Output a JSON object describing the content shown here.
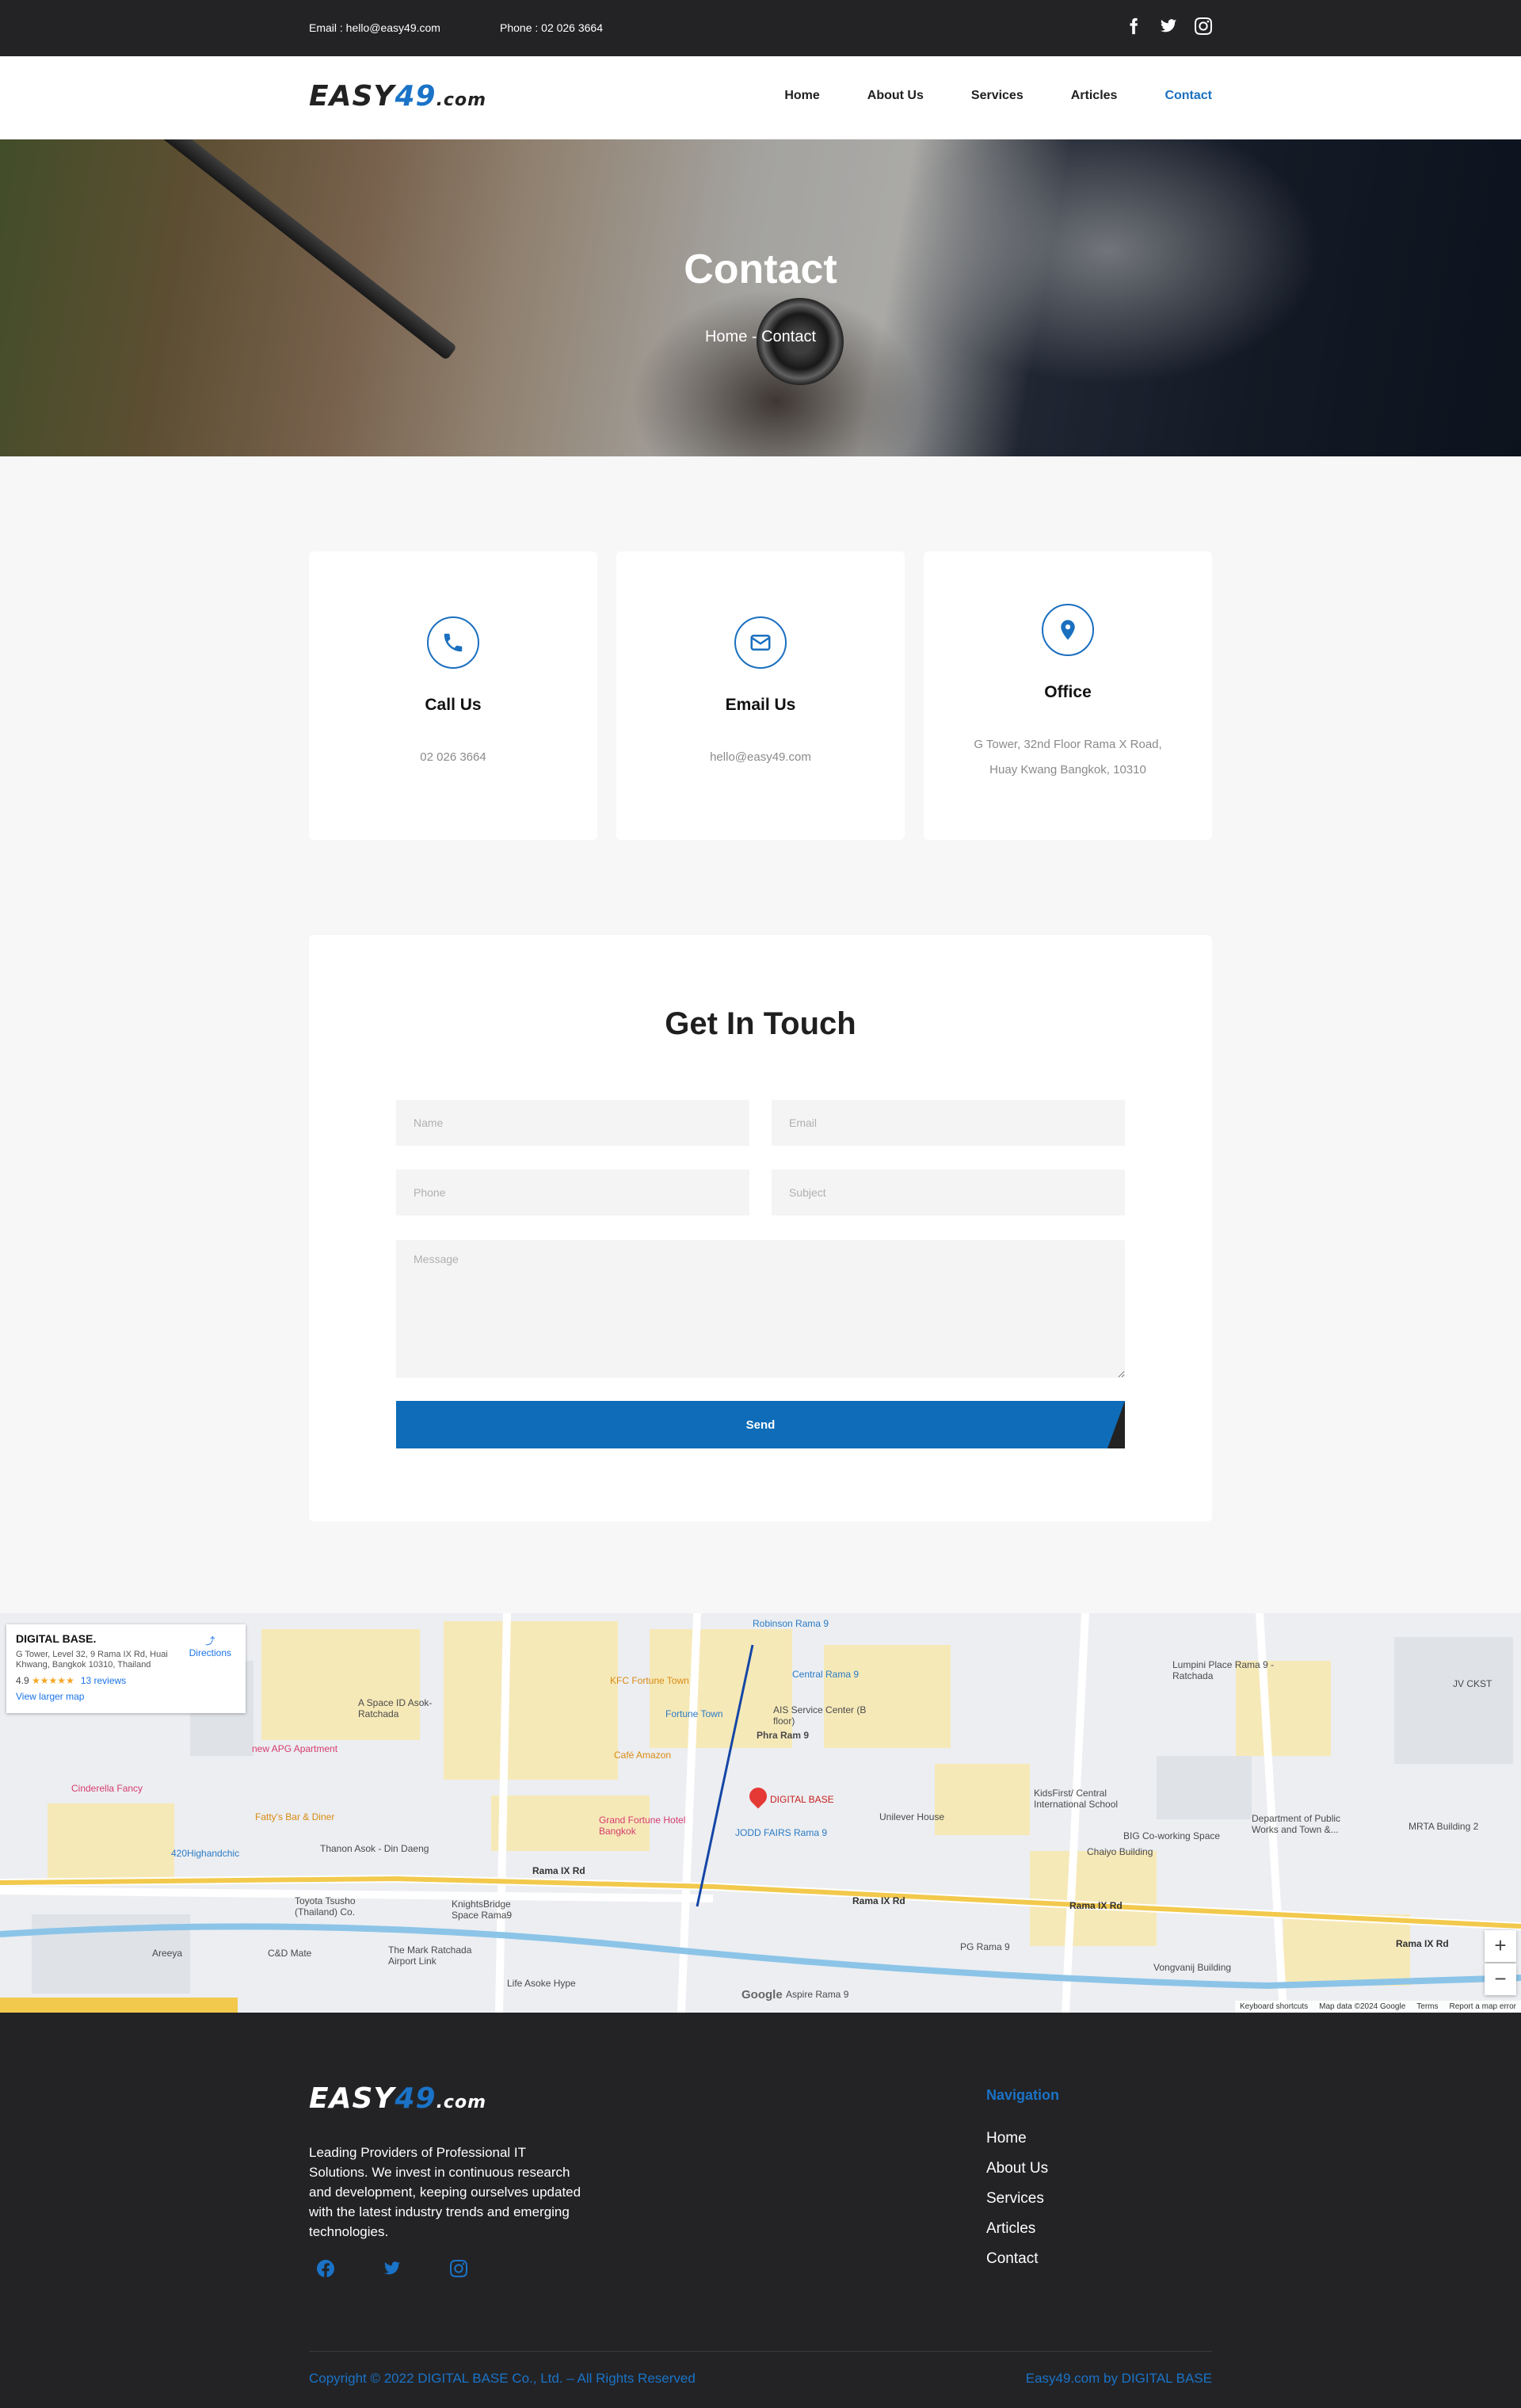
{
  "topbar": {
    "email": "Email : hello@easy49.com",
    "phone": "Phone : 02 026 3664",
    "social_icons": [
      "facebook-icon",
      "twitter-icon",
      "instagram-icon"
    ]
  },
  "logo": {
    "part1": "EASY",
    "part2": "49",
    "part3": ".com"
  },
  "nav": [
    {
      "label": "Home",
      "active": false
    },
    {
      "label": "About Us",
      "active": false
    },
    {
      "label": "Services",
      "active": false
    },
    {
      "label": "Articles",
      "active": false
    },
    {
      "label": "Contact",
      "active": true
    }
  ],
  "hero": {
    "title": "Contact",
    "breadcrumb": "Home - Contact"
  },
  "cards": [
    {
      "icon": "phone-icon",
      "title": "Call Us",
      "lines": [
        "02 026 3664"
      ]
    },
    {
      "icon": "mail-icon",
      "title": "Email Us",
      "lines": [
        "hello@easy49.com"
      ]
    },
    {
      "icon": "location-pin-icon",
      "title": "Office",
      "lines": [
        "G Tower, 32nd Floor Rama X Road,",
        "Huay Kwang Bangkok, 10310"
      ]
    }
  ],
  "form": {
    "heading": "Get In Touch",
    "name_placeholder": "Name",
    "email_placeholder": "Email",
    "phone_placeholder": "Phone",
    "subject_placeholder": "Subject",
    "message_placeholder": "Message",
    "send_label": "Send"
  },
  "map": {
    "card_title": "DIGITAL BASE.",
    "card_address": "G Tower, Level 32, 9 Rama IX Rd, Huai Khwang, Bangkok 10310, Thailand",
    "rating": "4.9",
    "stars": "★★★★★",
    "reviews": "13 reviews",
    "larger_map": "View larger map",
    "directions": "Directions",
    "marker_label": "DIGITAL BASE",
    "labels": {
      "robinson": "Robinson Rama 9",
      "central": "Central Rama 9",
      "kfc": "KFC Fortune Town",
      "fortune": "Fortune Town",
      "ais": "AIS Service Center (B floor)",
      "phraram9": "Phra Ram 9",
      "cafe": "Café Amazon",
      "grand": "Grand Fortune Hotel Bangkok",
      "joddfairs": "JODD FAIRS Rama 9",
      "unilever": "Unilever House",
      "kidsfirst": "KidsFirst/ Central International School",
      "bigcowork": "BIG Co-working Space",
      "chaiyo": "Chaiyo Building",
      "lumpini": "Lumpini Place Rama 9 - Ratchada",
      "apg": "new APG Apartment",
      "cinderella": "Cinderella Fancy",
      "fattys": "Fatty's Bar & Diner",
      "highandchic": "420Highandchic",
      "asoke": "Thanon Asok - Din Daeng",
      "toyota": "Toyota Tsusho (Thailand) Co.",
      "knights": "KnightsBridge Space Rama9",
      "mark": "The Mark Ratchada Airport Link",
      "cdmate": "C&D Mate",
      "areeya": "Areeya",
      "lifeasoke": "Life Asoke Hype",
      "aspire": "Aspire Rama 9",
      "pgrama9": "PG Rama 9",
      "vongvanij": "Vongvanij Building",
      "dept": "Department of Public Works and Town &...",
      "mrta": "MRTA Building 2",
      "jvckst": "JV CKST",
      "rama9rd": "Rama IX Rd",
      "asokespace": "A Space ID Asok-Ratchada"
    },
    "attribution": [
      "Keyboard shortcuts",
      "Map data ©2024 Google",
      "Terms",
      "Report a map error"
    ],
    "zoom_in": "+",
    "zoom_out": "−",
    "google_label": "Google"
  },
  "footer": {
    "description": "Leading Providers of Professional IT Solutions. We invest in continuous research and development, keeping ourselves updated with the latest industry trends and emerging technologies.",
    "nav_heading": "Navigation",
    "links": [
      "Home",
      "About Us",
      "Services",
      "Articles",
      "Contact"
    ],
    "copyright": "Copyright © 2022 DIGITAL BASE Co., Ltd. – All Rights Reserved",
    "credit": "Easy49.com by DIGITAL BASE"
  },
  "colors": {
    "accent": "#1a6fbf",
    "dark": "#232326",
    "field_bg": "#f4f4f4"
  }
}
